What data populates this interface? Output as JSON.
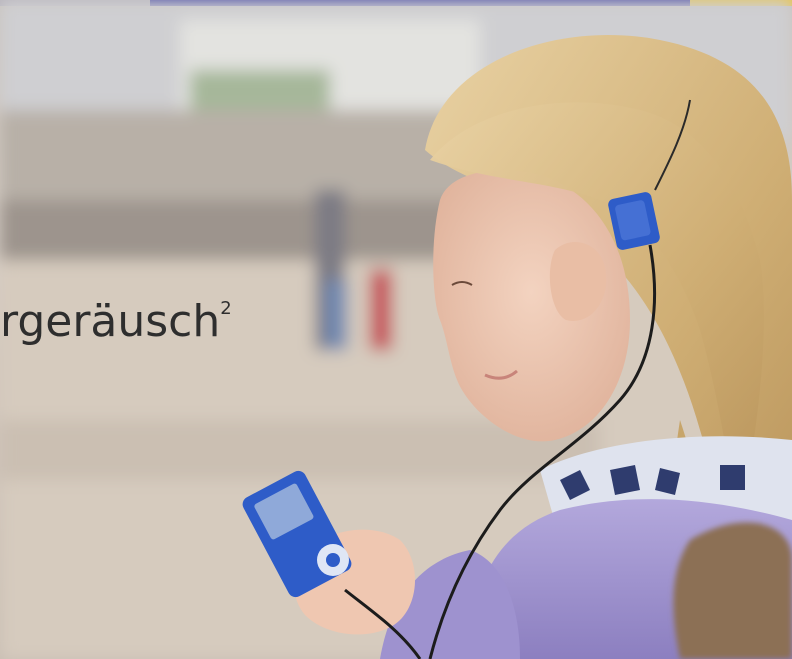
{
  "caption": {
    "text": "rgeräusch",
    "superscript": "2"
  },
  "colors": {
    "top_banner_blue": "#3d3f9f",
    "device_blue": "#2e5cc8",
    "jacket_lilac": "#a79ad1",
    "hair_blonde": "#d8bb86"
  },
  "icons": [
    "hearing-processor-icon",
    "mp3-player-icon"
  ]
}
